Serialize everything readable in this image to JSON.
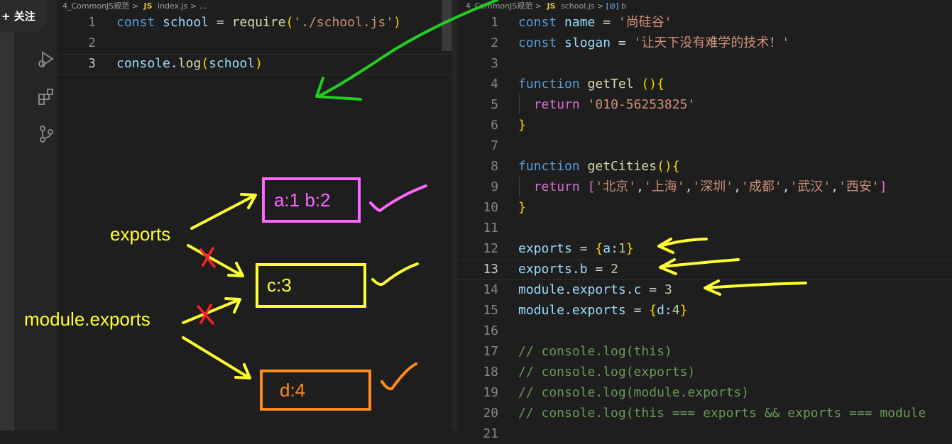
{
  "follow_button": {
    "label": "+ 关注"
  },
  "left_editor": {
    "breadcrumb": {
      "folder": "4_CommonJS规范",
      "sep1": ">",
      "js_badge": "JS",
      "file": "index.js",
      "sep2": ">",
      "tail": "..."
    },
    "lines": [
      {
        "num": "1",
        "tokens": [
          [
            "k",
            "const"
          ],
          [
            "p",
            " "
          ],
          [
            "v",
            "school"
          ],
          [
            "p",
            " = "
          ],
          [
            "f",
            "require"
          ],
          [
            "br",
            "("
          ],
          [
            "s",
            "'./school.js'"
          ],
          [
            "br",
            ")"
          ]
        ]
      },
      {
        "num": "2",
        "tokens": []
      },
      {
        "num": "3",
        "tokens": [
          [
            "v",
            "console"
          ],
          [
            "p",
            "."
          ],
          [
            "f",
            "log"
          ],
          [
            "br",
            "("
          ],
          [
            "v",
            "school"
          ],
          [
            "br",
            ")"
          ]
        ]
      }
    ]
  },
  "right_editor": {
    "breadcrumb": {
      "folder": "4_CommonJS规范",
      "sep1": ">",
      "js_badge": "JS",
      "file": "school.js",
      "sep2": ">",
      "symbol_icon": "[⊘]",
      "symbol": "b"
    },
    "lines": [
      {
        "num": "1",
        "tokens": [
          [
            "k",
            "const"
          ],
          [
            "p",
            " "
          ],
          [
            "v",
            "name"
          ],
          [
            "p",
            " = "
          ],
          [
            "s",
            "'尚硅谷'"
          ]
        ]
      },
      {
        "num": "2",
        "tokens": [
          [
            "k",
            "const"
          ],
          [
            "p",
            " "
          ],
          [
            "v",
            "slogan"
          ],
          [
            "p",
            " = "
          ],
          [
            "s",
            "'让天下没有难学的技术！'"
          ]
        ]
      },
      {
        "num": "3",
        "tokens": []
      },
      {
        "num": "4",
        "tokens": [
          [
            "k",
            "function"
          ],
          [
            "p",
            " "
          ],
          [
            "f",
            "getTel"
          ],
          [
            "p",
            " "
          ],
          [
            "br",
            "()"
          ],
          [
            "br",
            "{"
          ]
        ]
      },
      {
        "num": "5",
        "tokens": [
          [
            "p",
            "  "
          ],
          [
            "br2",
            "return"
          ],
          [
            "p",
            " "
          ],
          [
            "s",
            "'010-56253825'"
          ]
        ]
      },
      {
        "num": "6",
        "tokens": [
          [
            "br",
            "}"
          ]
        ]
      },
      {
        "num": "7",
        "tokens": []
      },
      {
        "num": "8",
        "tokens": [
          [
            "k",
            "function"
          ],
          [
            "p",
            " "
          ],
          [
            "f",
            "getCities"
          ],
          [
            "br",
            "()"
          ],
          [
            "br",
            "{"
          ]
        ]
      },
      {
        "num": "9",
        "tokens": [
          [
            "p",
            "  "
          ],
          [
            "br2",
            "return"
          ],
          [
            "p",
            " "
          ],
          [
            "br2",
            "["
          ],
          [
            "s",
            "'北京'"
          ],
          [
            "p",
            ","
          ],
          [
            "s",
            "'上海'"
          ],
          [
            "p",
            ","
          ],
          [
            "s",
            "'深圳'"
          ],
          [
            "p",
            ","
          ],
          [
            "s",
            "'成都'"
          ],
          [
            "p",
            ","
          ],
          [
            "s",
            "'武汉'"
          ],
          [
            "p",
            ","
          ],
          [
            "s",
            "'西安'"
          ],
          [
            "br2",
            "]"
          ]
        ]
      },
      {
        "num": "10",
        "tokens": [
          [
            "br",
            "}"
          ]
        ]
      },
      {
        "num": "11",
        "tokens": []
      },
      {
        "num": "12",
        "tokens": [
          [
            "v",
            "exports"
          ],
          [
            "p",
            " = "
          ],
          [
            "br",
            "{"
          ],
          [
            "v",
            "a"
          ],
          [
            "p",
            ":"
          ],
          [
            "n",
            "1"
          ],
          [
            "br",
            "}"
          ]
        ]
      },
      {
        "num": "13",
        "tokens": [
          [
            "v",
            "exports"
          ],
          [
            "p",
            "."
          ],
          [
            "v",
            "b"
          ],
          [
            "p",
            " = "
          ],
          [
            "n",
            "2"
          ]
        ]
      },
      {
        "num": "14",
        "tokens": [
          [
            "v",
            "module"
          ],
          [
            "p",
            "."
          ],
          [
            "v",
            "exports"
          ],
          [
            "p",
            "."
          ],
          [
            "v",
            "c"
          ],
          [
            "p",
            " = "
          ],
          [
            "n",
            "3"
          ]
        ]
      },
      {
        "num": "15",
        "tokens": [
          [
            "v",
            "module"
          ],
          [
            "p",
            "."
          ],
          [
            "v",
            "exports"
          ],
          [
            "p",
            " = "
          ],
          [
            "br",
            "{"
          ],
          [
            "v",
            "d"
          ],
          [
            "p",
            ":"
          ],
          [
            "n",
            "4"
          ],
          [
            "br",
            "}"
          ]
        ]
      },
      {
        "num": "16",
        "tokens": []
      },
      {
        "num": "17",
        "tokens": [
          [
            "c",
            "// console.log(this)"
          ]
        ]
      },
      {
        "num": "18",
        "tokens": [
          [
            "c",
            "// console.log(exports)"
          ]
        ]
      },
      {
        "num": "19",
        "tokens": [
          [
            "c",
            "// console.log(module.exports)"
          ]
        ]
      },
      {
        "num": "20",
        "tokens": [
          [
            "c",
            "// console.log(this === exports && exports === module"
          ]
        ]
      },
      {
        "num": "21",
        "tokens": []
      }
    ]
  },
  "annotations": {
    "exports_label": "exports",
    "module_exports_label": "module.exports",
    "box_ab": "a:1  b:2",
    "box_c": "c:3",
    "box_d": "d:4",
    "colors": {
      "yellow": "#ffff33",
      "pink": "#ff66ff",
      "orange": "#ff8c1a",
      "green": "#22cc22",
      "red": "#ff2020"
    }
  }
}
